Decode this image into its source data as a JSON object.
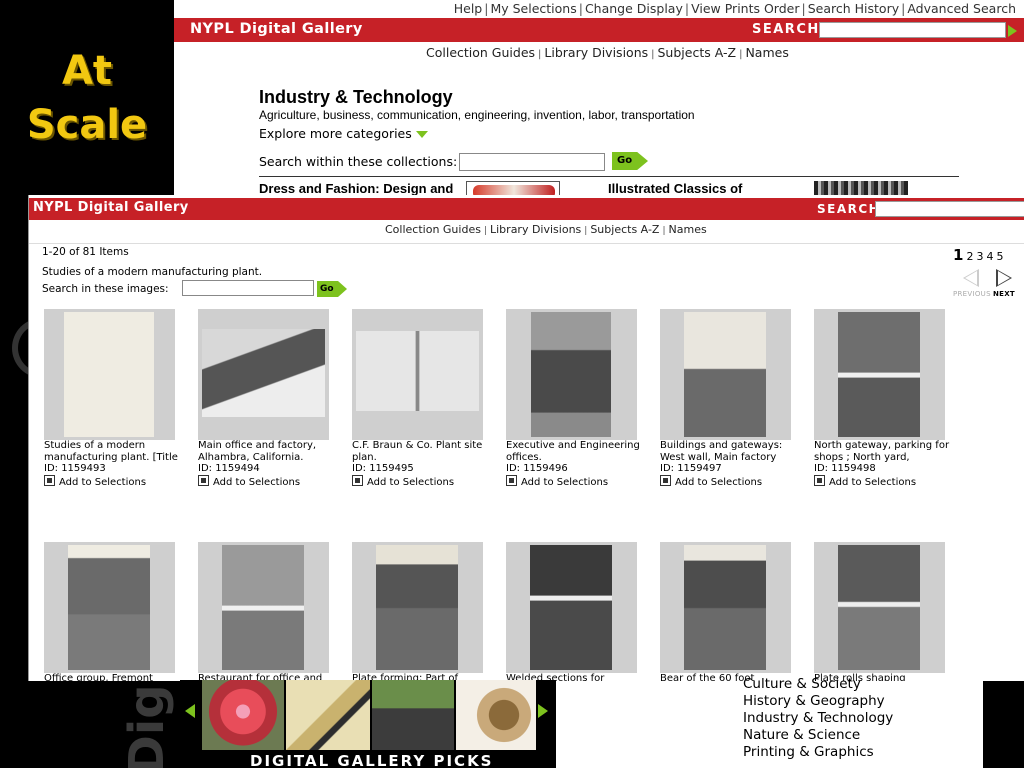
{
  "slide": {
    "title_line1": "At",
    "title_line2": "Scale",
    "watermark": "Digi"
  },
  "back_window": {
    "utility_links": [
      "Help",
      "My Selections",
      "Change Display",
      "View Prints Order",
      "Search History",
      "Advanced Search"
    ],
    "logo": "NYPL Digital Gallery",
    "search_label": "SEARCH",
    "nav": [
      "Collection Guides",
      "Library Divisions",
      "Subjects A-Z",
      "Names"
    ],
    "title": "Industry & Technology",
    "subtitle": "Agriculture, business, communication, engineering, invention, labor, transportation",
    "explore": "Explore more categories",
    "search_within_label": "Search within these collections:",
    "go_label": "Go",
    "collections": [
      "Dress and Fashion: Design and",
      "Illustrated Classics of"
    ]
  },
  "front_window": {
    "logo": "NYPL Digital Gallery",
    "search_label": "SEARCH",
    "nav": [
      "Collection Guides",
      "Library Divisions",
      "Subjects A-Z",
      "Names"
    ],
    "count": "1-20 of 81 Items",
    "description": "Studies of a modern manufacturing plant.",
    "search_images_label": "Search in these images:",
    "go_label": "Go",
    "pages": [
      "1",
      "2",
      "3",
      "4",
      "5"
    ],
    "previous_label": "PREVIOUS",
    "next_label": "NEXT",
    "add_label": "Add to Selections",
    "items": [
      {
        "title": "Studies of a modern manufacturing plant. [Title",
        "id": "ID: 1159493"
      },
      {
        "title": "Main office and factory, Alhambra, California.",
        "id": "ID: 1159494"
      },
      {
        "title": "C.F. Braun & Co. Plant site plan.",
        "id": "ID: 1159495"
      },
      {
        "title": "Executive and Engineering offices.",
        "id": "ID: 1159496"
      },
      {
        "title": "Buildings and gateways: West wall, Main factory",
        "id": "ID: 1159497"
      },
      {
        "title": "North gateway, parking for shops ; North yard,",
        "id": "ID: 1159498"
      },
      {
        "title": "Office group, Fremont",
        "id": ""
      },
      {
        "title": "Restaurant for office and",
        "id": ""
      },
      {
        "title": "Plate forming; Part of",
        "id": ""
      },
      {
        "title": "Welded sections for",
        "id": ""
      },
      {
        "title": "Bear of the 60 foot",
        "id": ""
      },
      {
        "title": "Plate rolls shaping",
        "id": ""
      }
    ]
  },
  "bottom": {
    "gallery_picks_label": "DIGITAL GALLERY PICKS",
    "subjects": [
      "Culture & Society",
      "History & Geography",
      "Industry & Technology",
      "Nature & Science",
      "Printing & Graphics"
    ]
  },
  "colors": {
    "nypl_red": "#c62127",
    "go_green": "#7dc21e",
    "slide_title": "#f2c811"
  }
}
